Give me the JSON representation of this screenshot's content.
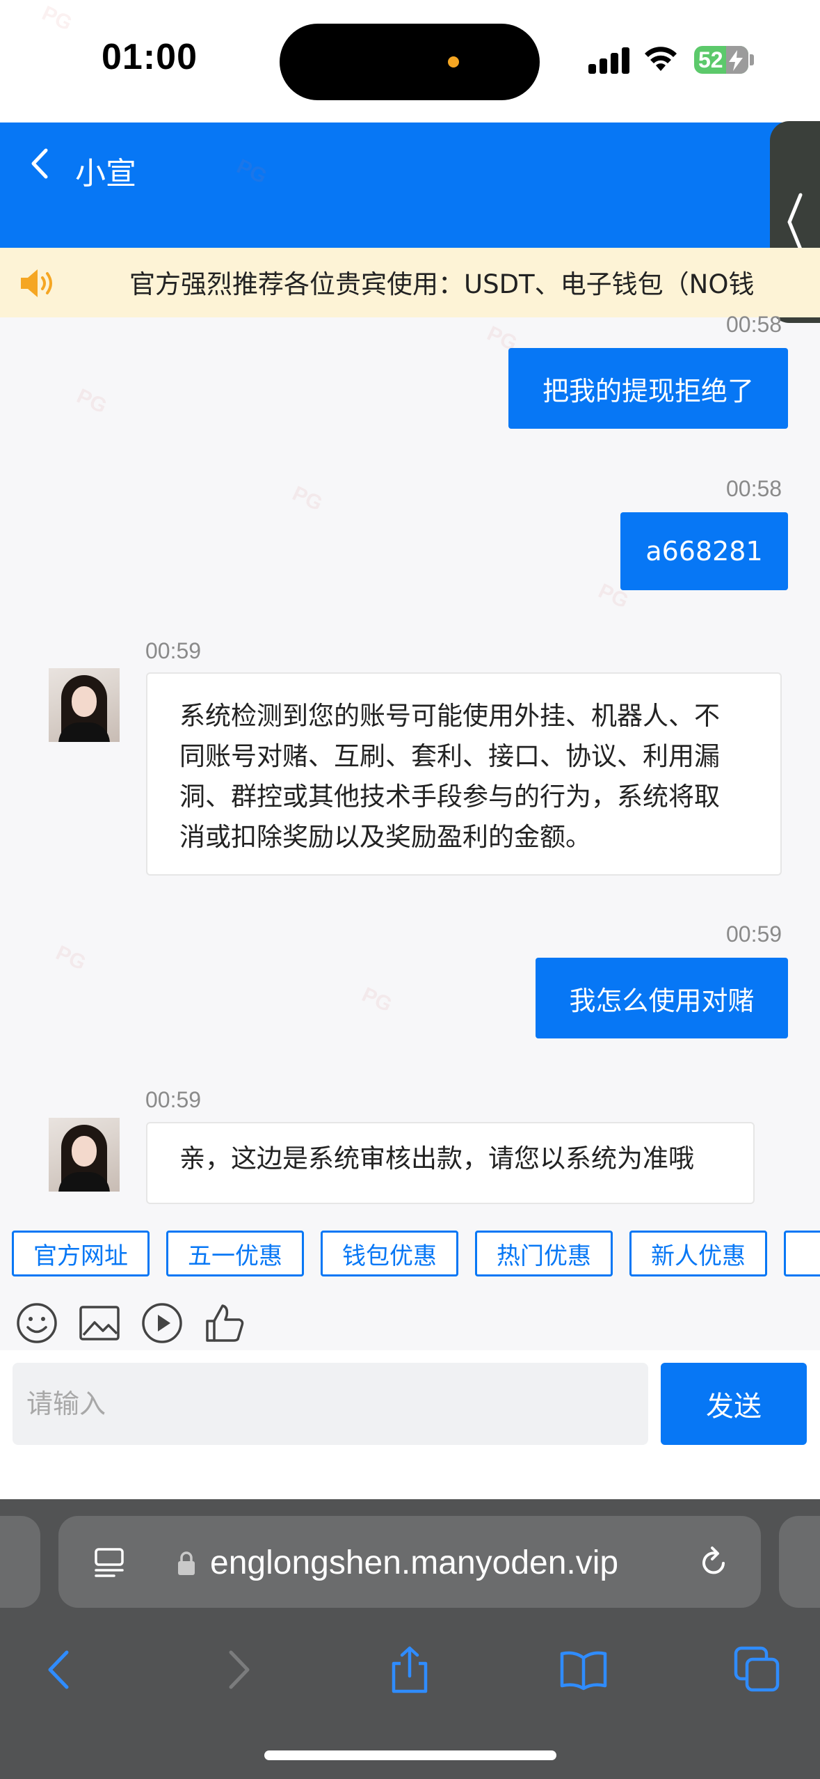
{
  "status_bar": {
    "time": "01:00",
    "battery": "52"
  },
  "header": {
    "title": "小宣"
  },
  "notice": {
    "text": "官方强烈推荐各位贵宾使用：USDT、电子钱包（NO钱"
  },
  "messages": [
    {
      "direction": "out",
      "time": "00:58",
      "text": "把我的提现拒绝了"
    },
    {
      "direction": "out",
      "time": "00:58",
      "text": "a668281"
    },
    {
      "direction": "in",
      "time": "00:59",
      "lines": [
        "系统检测到您的账号可能使用外挂、机器人、不",
        "同账号对赌、互刷、套利、接口、协议、利用漏",
        "洞、群控或其他技术手段参与的行为，系统将取",
        "消或扣除奖励以及奖励盈利的金额。"
      ]
    },
    {
      "direction": "out",
      "time": "00:59",
      "text": "我怎么使用对赌"
    },
    {
      "direction": "in",
      "time": "00:59",
      "text": "亲，这边是系统审核出款，请您以系统为准哦"
    }
  ],
  "quick_replies": [
    "官方网址",
    "五一优惠",
    "钱包优惠",
    "热门优惠",
    "新人优惠"
  ],
  "input": {
    "placeholder": "请输入",
    "send_label": "发送"
  },
  "browser": {
    "url": "englongshen.manyoden.vip"
  },
  "colors": {
    "primary": "#0777f5",
    "notice_bg": "#fdf3d6",
    "browser_bg": "#525354"
  }
}
